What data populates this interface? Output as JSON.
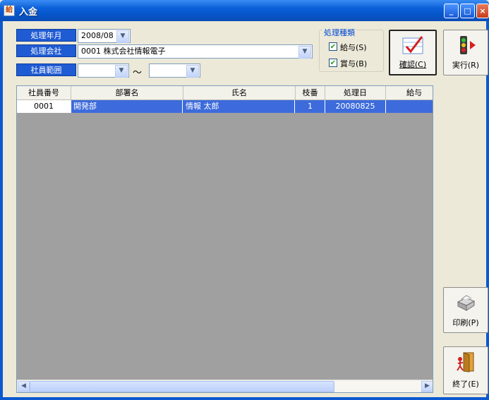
{
  "window": {
    "title": "入金",
    "app_icon": "給",
    "minimize": "_",
    "maximize": "□",
    "close": "×"
  },
  "filters": {
    "period_label": "処理年月",
    "period_value": "2008/08",
    "company_label": "処理会社",
    "company_value": "0001  株式会社情報電子",
    "range_label": "社員範囲",
    "range_from": "",
    "range_sep": "～",
    "range_to": ""
  },
  "process_type": {
    "title": "処理種類",
    "salary_label": "給与(S)",
    "salary_checked": true,
    "bonus_label": "賞与(B)",
    "bonus_checked": true
  },
  "buttons": {
    "confirm": "確認(C)",
    "execute": "実行(R)",
    "print": "印刷(P)",
    "exit": "終了(E)"
  },
  "grid": {
    "columns": [
      "社員番号",
      "部署名",
      "氏名",
      "枝番",
      "処理日",
      "給与"
    ],
    "rows": [
      [
        "0001",
        "開発部",
        "情報 太郎",
        "1",
        "20080825",
        ""
      ]
    ]
  },
  "colors": {
    "title_bar": "#0654c8",
    "label_bg": "#1f5bd3",
    "selected_row": "#3d6bdc",
    "grid_bg": "#a0a0a0"
  }
}
